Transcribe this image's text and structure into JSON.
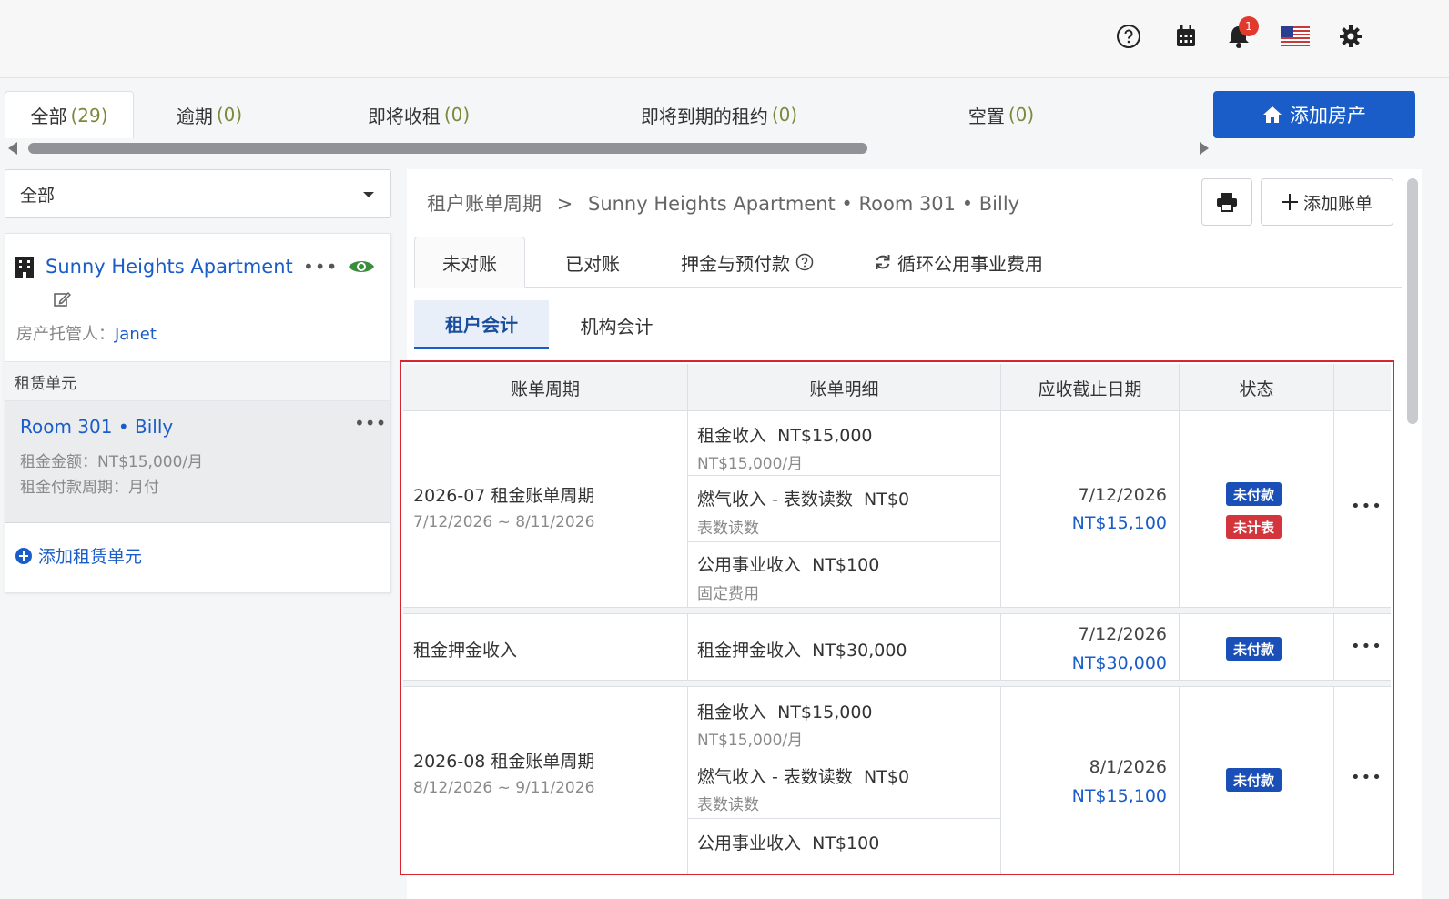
{
  "header": {
    "notification_count": "1"
  },
  "filter_tabs": [
    {
      "label": "全部",
      "count": "(29)"
    },
    {
      "label": "逾期",
      "count": "(0)"
    },
    {
      "label": "即将收租",
      "count": "(0)"
    },
    {
      "label": "即将到期的租约",
      "count": "(0)"
    },
    {
      "label": "空置",
      "count": "(0)"
    }
  ],
  "add_property_label": "添加房产",
  "left": {
    "select_value": "全部",
    "property_name": "Sunny Heights Apartment",
    "manager_label": "房产托管人：",
    "manager_name": "Janet",
    "units_header": "租赁单元",
    "unit": {
      "title": "Room 301 • Billy",
      "rent": "租金金额：NT$15,000/月",
      "cycle": "租金付款周期：月付"
    },
    "add_unit_label": "添加租赁单元"
  },
  "main": {
    "breadcrumb": {
      "root": "租户账单周期",
      "sep": ">",
      "current": "Sunny Heights Apartment • Room 301 • Billy"
    },
    "add_bill_label": "添加账单",
    "sub_tabs": [
      "未对账",
      "已对账",
      "押金与预付款",
      "循环公用事业费用"
    ],
    "acct_tabs": [
      "租户会计",
      "机构会计"
    ],
    "table": {
      "headers": [
        "账单周期",
        "账单明细",
        "应收截止日期",
        "状态"
      ],
      "rows": [
        {
          "period": "2026-07 租金账单周期",
          "period_range": "7/12/2026 ~ 8/11/2026",
          "details": [
            {
              "name": "租金收入",
              "amount": "NT$15,000",
              "note": "NT$15,000/月"
            },
            {
              "name": "燃气收入 - 表数读数",
              "amount": "NT$0",
              "note": "表数读数"
            },
            {
              "name": "公用事业收入",
              "amount": "NT$100",
              "note": "固定费用"
            }
          ],
          "due_date": "7/12/2026",
          "due_amount": "NT$15,100",
          "statuses": [
            "未付款",
            "未计表"
          ]
        },
        {
          "period": "租金押金收入",
          "details": [
            {
              "name": "租金押金收入",
              "amount": "NT$30,000"
            }
          ],
          "due_date": "7/12/2026",
          "due_amount": "NT$30,000",
          "statuses": [
            "未付款"
          ]
        },
        {
          "period": "2026-08 租金账单周期",
          "period_range": "8/12/2026 ~ 9/11/2026",
          "details": [
            {
              "name": "租金收入",
              "amount": "NT$15,000",
              "note": "NT$15,000/月"
            },
            {
              "name": "燃气收入 - 表数读数",
              "amount": "NT$0",
              "note": "表数读数"
            },
            {
              "name": "公用事业收入",
              "amount": "NT$100"
            }
          ],
          "due_date": "8/1/2026",
          "due_amount": "NT$15,100",
          "statuses": [
            "未付款"
          ]
        }
      ]
    }
  },
  "colors": {
    "primary": "#1a5dc8",
    "unpaid": "#1a4fb8",
    "unmetered": "#d2353c",
    "highlight_border": "#d9252f"
  }
}
